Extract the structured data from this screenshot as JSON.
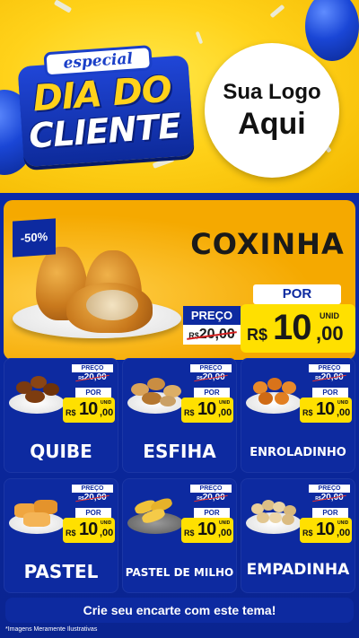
{
  "header": {
    "title_special": "especial",
    "title_line1": "DIA DO",
    "title_line2": "CLIENTE",
    "logo_line1": "Sua Logo",
    "logo_line2": "Aqui"
  },
  "featured": {
    "discount": "-50%",
    "name": "COXINHA",
    "preco_label": "PREÇO",
    "old_currency": "R$",
    "old_price": "20,00",
    "por_label": "POR",
    "currency": "R$",
    "price_int": "10",
    "price_dec": ",00",
    "unit": "UNID"
  },
  "products": [
    {
      "name": "QUIBE",
      "preco_label": "PREÇO",
      "old_currency": "R$",
      "old_price": "20,00",
      "por_label": "POR",
      "currency": "R$",
      "price_int": "10",
      "price_dec": ",00",
      "unit": "UNID"
    },
    {
      "name": "ESFIHA",
      "preco_label": "PREÇO",
      "old_currency": "R$",
      "old_price": "20,00",
      "por_label": "POR",
      "currency": "R$",
      "price_int": "10",
      "price_dec": ",00",
      "unit": "UNID"
    },
    {
      "name": "ENROLADINHO",
      "preco_label": "PREÇO",
      "old_currency": "R$",
      "old_price": "20,00",
      "por_label": "POR",
      "currency": "R$",
      "price_int": "10",
      "price_dec": ",00",
      "unit": "UNID"
    },
    {
      "name": "PASTEL",
      "preco_label": "PREÇO",
      "old_currency": "R$",
      "old_price": "20,00",
      "por_label": "POR",
      "currency": "R$",
      "price_int": "10",
      "price_dec": ",00",
      "unit": "UNID"
    },
    {
      "name": "PASTEL DE MILHO",
      "preco_label": "PREÇO",
      "old_currency": "R$",
      "old_price": "20,00",
      "por_label": "POR",
      "currency": "R$",
      "price_int": "10",
      "price_dec": ",00",
      "unit": "UNID"
    },
    {
      "name": "EMPADINHA",
      "preco_label": "PREÇO",
      "old_currency": "R$",
      "old_price": "20,00",
      "por_label": "POR",
      "currency": "R$",
      "price_int": "10",
      "price_dec": ",00",
      "unit": "UNID"
    }
  ],
  "footer": {
    "cta": "Crie seu encarte com este tema!",
    "disclaimer": "*Imagens Meramente Ilustrativas"
  },
  "colors": {
    "brand_blue": "#0d2aa0",
    "price_yellow": "#ffe000",
    "header_yellow": "#ffd21a",
    "featured_orange": "#f5a900"
  }
}
